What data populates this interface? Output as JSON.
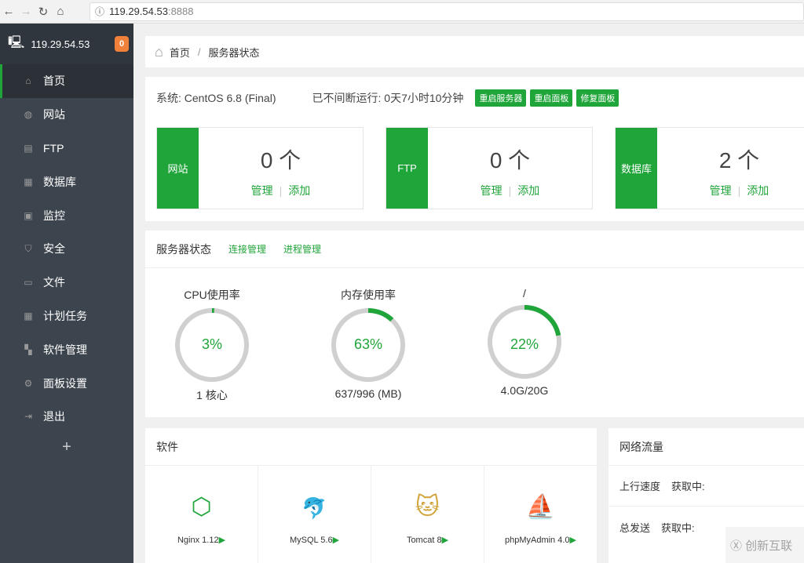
{
  "browser": {
    "url_host": "119.29.54.53",
    "url_port": ":8888"
  },
  "sidebar": {
    "server": "119.29.54.53",
    "badge": "0",
    "items": [
      {
        "label": "首页",
        "icon": "home-icon",
        "active": true
      },
      {
        "label": "网站",
        "icon": "globe-icon"
      },
      {
        "label": "FTP",
        "icon": "ftp-icon"
      },
      {
        "label": "数据库",
        "icon": "database-icon"
      },
      {
        "label": "监控",
        "icon": "monitor-icon"
      },
      {
        "label": "安全",
        "icon": "shield-icon"
      },
      {
        "label": "文件",
        "icon": "folder-icon"
      },
      {
        "label": "计划任务",
        "icon": "calendar-icon"
      },
      {
        "label": "软件管理",
        "icon": "grid-icon"
      },
      {
        "label": "面板设置",
        "icon": "gear-icon"
      },
      {
        "label": "退出",
        "icon": "logout-icon"
      }
    ],
    "add": "+"
  },
  "breadcrumb": {
    "home": "首页",
    "sep": "/",
    "current": "服务器状态"
  },
  "system": {
    "os": "系统: CentOS 6.8 (Final)",
    "uptime": "已不间断运行: 0天7小时10分钟",
    "buttons": [
      "重启服务器",
      "重启面板",
      "修复面板"
    ],
    "stats": [
      {
        "label": "网站",
        "count": "0 个",
        "manage": "管理",
        "add": "添加"
      },
      {
        "label": "FTP",
        "count": "0 个",
        "manage": "管理",
        "add": "添加"
      },
      {
        "label": "数据库",
        "count": "2 个",
        "manage": "管理",
        "add": "添加"
      }
    ]
  },
  "status": {
    "title": "服务器状态",
    "links": [
      "连接管理",
      "进程管理"
    ],
    "accent": "#20a53a",
    "gauges": [
      {
        "title": "CPU使用率",
        "value": "3%",
        "sub": "1 核心",
        "fill": 0.01
      },
      {
        "title": "内存使用率",
        "value": "63%",
        "sub": "637/996 (MB)",
        "fill": 0.12
      },
      {
        "title": "/",
        "value": "22%",
        "sub": "4.0G/20G",
        "fill": 0.22
      }
    ]
  },
  "software": {
    "title": "软件",
    "items": [
      {
        "name": "Nginx 1.12"
      },
      {
        "name": "MySQL 5.6"
      },
      {
        "name": "Tomcat 8"
      },
      {
        "name": "phpMyAdmin 4.0"
      }
    ]
  },
  "network": {
    "title": "网络流量",
    "rows": [
      {
        "label": "上行速度",
        "value": "获取中:"
      },
      {
        "label": "总发送",
        "value": "获取中:"
      }
    ]
  },
  "watermark": "创新互联"
}
